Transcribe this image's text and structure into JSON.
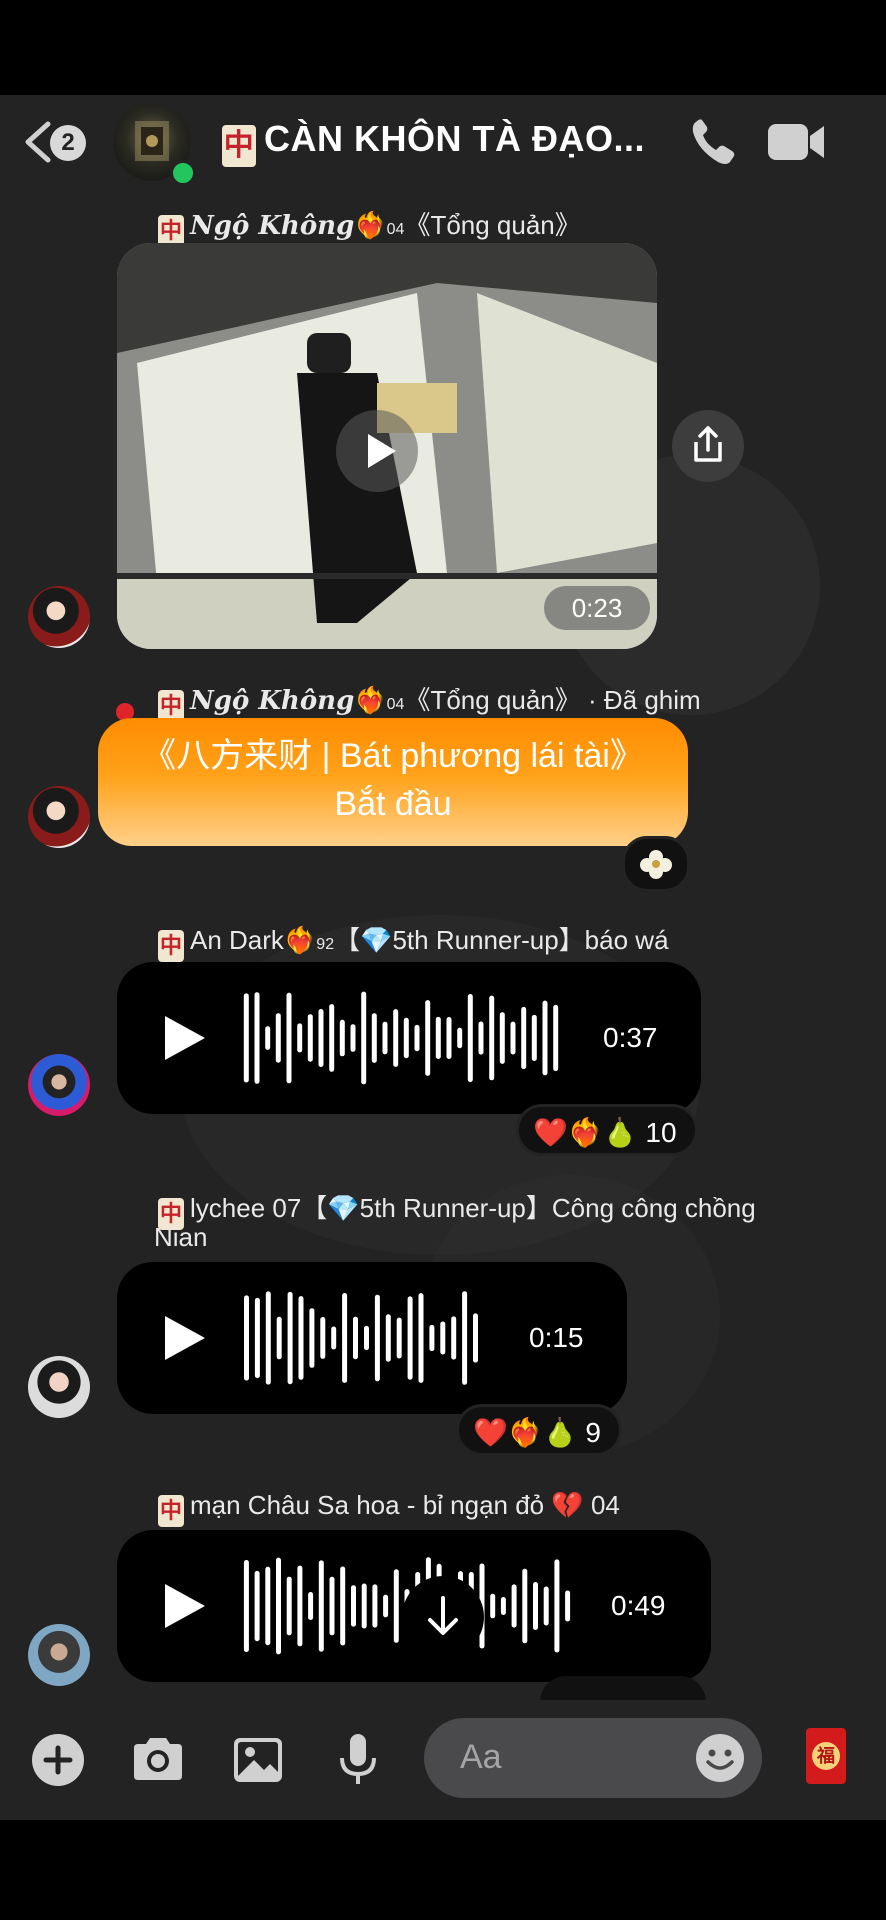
{
  "header": {
    "unread_count": "2",
    "title": "CÀN KHÔN TÀ ĐẠO..."
  },
  "messages": [
    {
      "sender_tile": "中",
      "sender_name": "Ngộ Không",
      "sender_level": "04",
      "sender_rank": "《Tổng quản》",
      "video_duration": "0:23"
    },
    {
      "sender_tile": "中",
      "sender_name": "Ngộ Không",
      "sender_level": "04",
      "sender_rank": "《Tổng quản》",
      "pinned_label": "· Đã ghim",
      "pinned_line1": "《八方来财 | Bát phương lái tài》",
      "pinned_line2": "Bắt đầu"
    },
    {
      "sender_tile": "中",
      "sender_name": "An Dark",
      "sender_level": "92",
      "sender_rank": "【💎5th Runner-up】báo wá",
      "audio_duration": "0:37",
      "reactions": "❤️❤️‍🔥🍐",
      "reaction_count": "10"
    },
    {
      "sender_tile": "中",
      "sender_text_line1": "lychee 07【💎5th Runner-up】Công công chồng",
      "sender_text_line2": "Nian",
      "audio_duration": "0:15",
      "reactions": "❤️❤️‍🔥🍐",
      "reaction_count": "9"
    },
    {
      "sender_tile": "中",
      "sender_text_line1": "mạn Châu Sa hoa - bỉ ngạn đỏ 💔 04",
      "audio_duration": "0:49"
    }
  ],
  "composer": {
    "placeholder": "Aa",
    "envelope_char": "福"
  }
}
